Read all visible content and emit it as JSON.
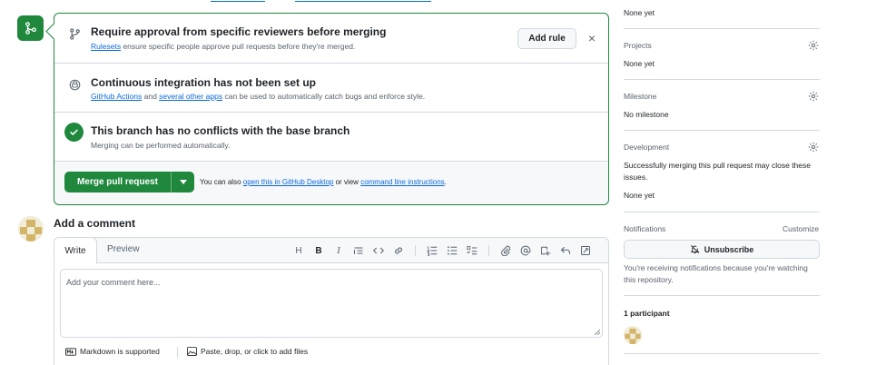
{
  "merge_box": {
    "approval": {
      "title": "Require approval from specific reviewers before merging",
      "link": "Rulesets",
      "desc": "ensure specific people approve pull requests before they're merged.",
      "add_rule": "Add rule",
      "close": "×"
    },
    "ci": {
      "title": "Continuous integration has not been set up",
      "link1": "GitHub Actions",
      "and": "and",
      "link2": "several other apps",
      "desc": "can be used to automatically catch bugs and enforce style."
    },
    "conflicts": {
      "title": "This branch has no conflicts with the base branch",
      "desc": "Merging can be performed automatically."
    },
    "merge": {
      "button": "Merge pull request",
      "also": "You can also",
      "link1": "open this in GitHub Desktop",
      "or_view": "or view",
      "link2": "command line instructions",
      "period": "."
    }
  },
  "comment": {
    "title": "Add a comment",
    "tab_write": "Write",
    "tab_preview": "Preview",
    "toolbar": [
      "H",
      "B",
      "I"
    ],
    "placeholder": "Add your comment here...",
    "markdown": "Markdown is supported",
    "attach": "Paste, drop, or click to add files"
  },
  "sidebar": {
    "reviewers_value": "None yet",
    "projects": {
      "label": "Projects",
      "value": "None yet"
    },
    "milestone": {
      "label": "Milestone",
      "value": "No milestone"
    },
    "development": {
      "label": "Development",
      "line1": "Successfully merging this pull request may close these",
      "line2": "issues.",
      "value": "None yet"
    },
    "notifications": {
      "label": "Notifications",
      "customize": "Customize",
      "unsubscribe": "Unsubscribe",
      "line1": "You're receiving notifications because you're watching",
      "line2": "this repository."
    },
    "participants": {
      "label": "1 participant"
    }
  },
  "colors": {
    "green": "#1f883d",
    "link": "#0969da",
    "border": "#d1d9e0"
  }
}
